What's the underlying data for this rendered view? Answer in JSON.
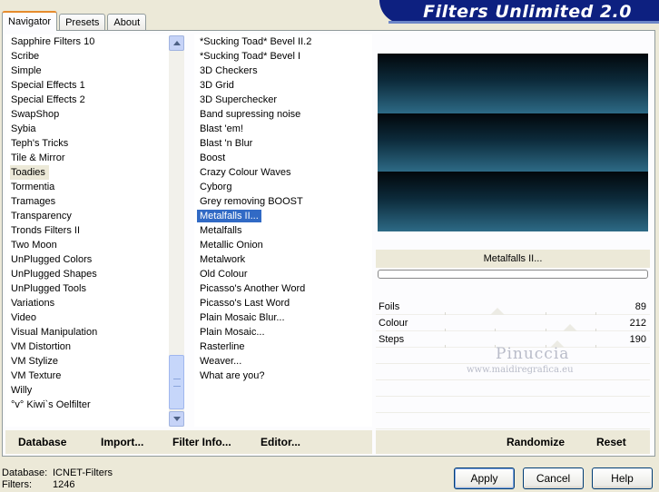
{
  "tabs": [
    {
      "label": "Navigator",
      "active": true
    },
    {
      "label": "Presets",
      "active": false
    },
    {
      "label": "About",
      "active": false
    }
  ],
  "banner_title": "Filters Unlimited 2.0",
  "categories": [
    "Sapphire Filters 10",
    "Scribe",
    "Simple",
    "Special Effects 1",
    "Special Effects 2",
    "SwapShop",
    "Sybia",
    "Teph's Tricks",
    "Tile & Mirror",
    "Toadies",
    "Tormentia",
    "Tramages",
    "Transparency",
    "Tronds Filters II",
    "Two Moon",
    "UnPlugged Colors",
    "UnPlugged Shapes",
    "UnPlugged Tools",
    "Variations",
    "Video",
    "Visual Manipulation",
    "VM Distortion",
    "VM Stylize",
    "VM Texture",
    "Willy",
    "°v° Kiwi`s Oelfilter"
  ],
  "selected_category": "Toadies",
  "filters": [
    "*Sucking Toad*  Bevel II.2",
    "*Sucking Toad*  Bevel I",
    "3D Checkers",
    "3D Grid",
    "3D Superchecker",
    "Band supressing noise",
    "Blast 'em!",
    "Blast 'n Blur",
    "Boost",
    "Crazy Colour Waves",
    "Cyborg",
    "Grey removing BOOST",
    "Metalfalls II...",
    "Metalfalls",
    "Metallic Onion",
    "Metalwork",
    "Old Colour",
    "Picasso's Another Word",
    "Picasso's Last Word",
    "Plain Mosaic Blur...",
    "Plain Mosaic...",
    "Rasterline",
    "Weaver...",
    "What are you?"
  ],
  "selected_filter": "Metalfalls II...",
  "preview": {
    "filter_name": "Metalfalls II..."
  },
  "sliders": [
    {
      "label": "Foils",
      "value": "89",
      "level": 89
    },
    {
      "label": "Colour",
      "value": "212",
      "level": 212
    },
    {
      "label": "Steps",
      "value": "190",
      "level": 190
    }
  ],
  "watermark": {
    "line1": "Pinuccia",
    "line2": "www.maidiregrafica.eu"
  },
  "toolbar_left": [
    {
      "label": "Database"
    },
    {
      "label": "Import..."
    },
    {
      "label": "Filter Info..."
    },
    {
      "label": "Editor..."
    }
  ],
  "toolbar_right": [
    {
      "label": "Randomize"
    },
    {
      "label": "Reset"
    }
  ],
  "status": {
    "database_key": "Database:",
    "database_value": "ICNET-Filters",
    "filters_key": "Filters:",
    "filters_value": "1246"
  },
  "buttons": {
    "apply": "Apply",
    "cancel": "Cancel",
    "help": "Help"
  }
}
